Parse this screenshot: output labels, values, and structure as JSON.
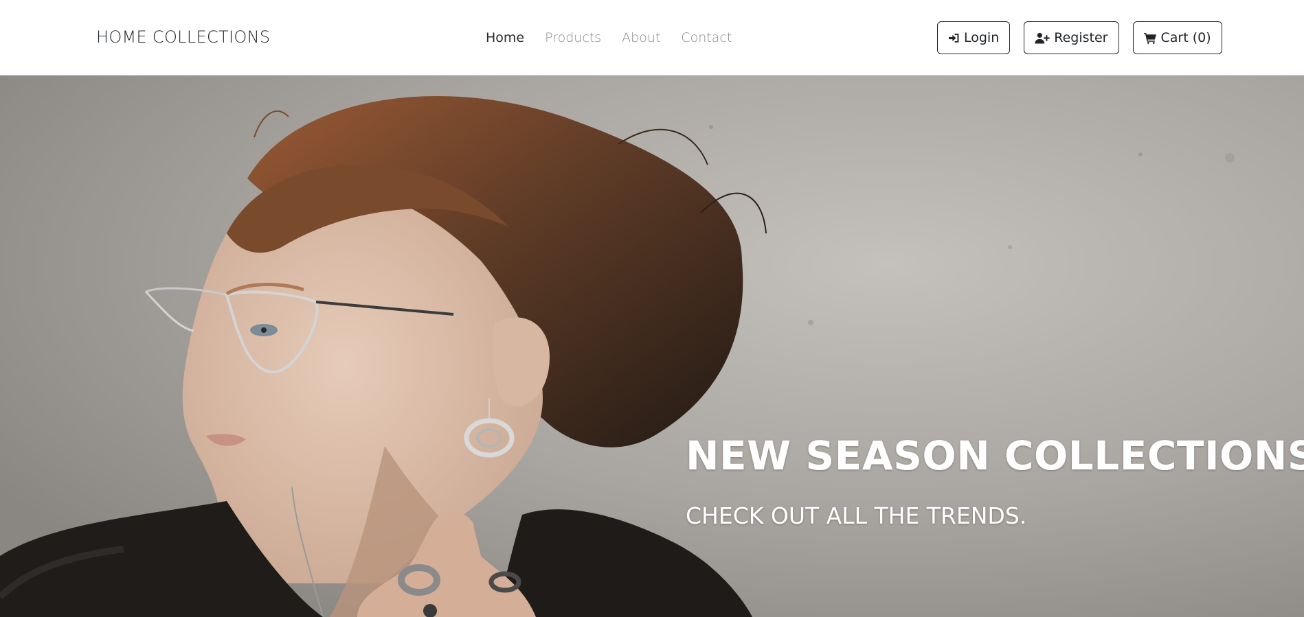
{
  "brand": {
    "name": "HOME COLLECTIONS"
  },
  "nav": {
    "links": [
      {
        "label": "Home",
        "active": true
      },
      {
        "label": "Products",
        "active": false
      },
      {
        "label": "About",
        "active": false
      },
      {
        "label": "Contact",
        "active": false
      }
    ]
  },
  "actions": {
    "login_label": "Login",
    "login_icon": "sign-in-icon",
    "register_label": "Register",
    "register_icon": "user-plus-icon",
    "cart_label": "Cart (0)",
    "cart_icon": "cart-icon"
  },
  "hero": {
    "title": "NEW SEASON COLLECTIONS",
    "subtitle": "CHECK OUT ALL THE TRENDS.",
    "image_subject": "woman with glasses and earrings",
    "text_color": "#ffffff",
    "background_color": "#a8a49f"
  },
  "colors": {
    "nav_text": "#212529",
    "nav_muted": "#8a8a8a",
    "border": "#212529"
  }
}
